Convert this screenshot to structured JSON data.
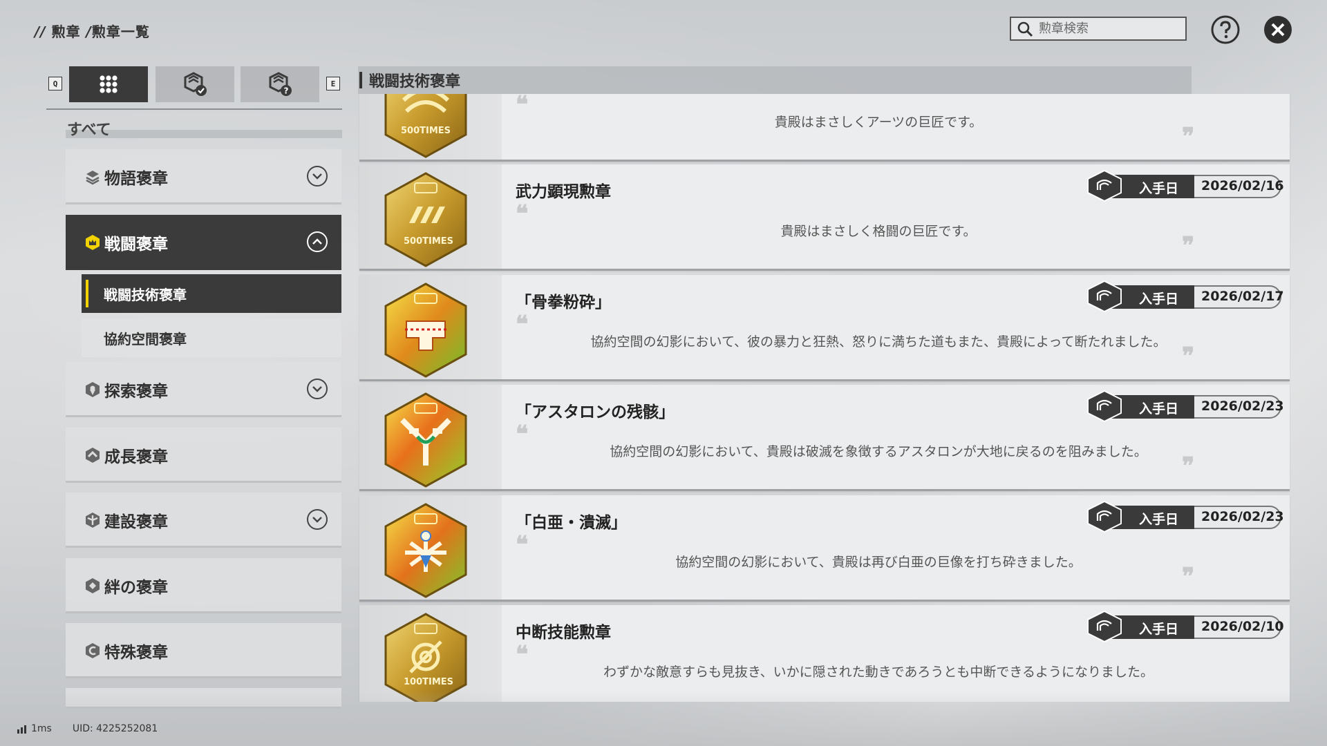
{
  "breadcrumb": {
    "prefix": "//",
    "part1": "勲章",
    "sep": "/",
    "part2": "勲章一覧"
  },
  "search": {
    "placeholder": "勲章検索",
    "value": ""
  },
  "header_buttons": {
    "help_icon": "question-circle-icon",
    "close_icon": "close-circle-icon"
  },
  "tabs": {
    "left_key": "Q",
    "right_key": "E",
    "items": [
      {
        "icon": "grid-icon",
        "active": true
      },
      {
        "icon": "medal-check-icon",
        "active": false
      },
      {
        "icon": "medal-question-icon",
        "active": false
      }
    ]
  },
  "filter": {
    "all_label": "すべて"
  },
  "categories": [
    {
      "label": "物語褒章",
      "icon": "story-icon",
      "expandable": true,
      "expanded": false
    },
    {
      "label": "戦闘褒章",
      "icon": "combat-icon",
      "expandable": true,
      "expanded": true
    },
    {
      "label": "探索褒章",
      "icon": "explore-icon",
      "expandable": true,
      "expanded": false
    },
    {
      "label": "成長褒章",
      "icon": "growth-icon",
      "expandable": false
    },
    {
      "label": "建設褒章",
      "icon": "build-icon",
      "expandable": true,
      "expanded": false
    },
    {
      "label": "絆の褒章",
      "icon": "bond-icon",
      "expandable": false
    },
    {
      "label": "特殊褒章",
      "icon": "special-icon",
      "expandable": false
    }
  ],
  "subcategories": [
    {
      "label": "戦闘技術褒章",
      "active": true
    },
    {
      "label": "協約空間褒章",
      "active": false
    }
  ],
  "section": {
    "title": "戦闘技術褒章"
  },
  "obtained_label": "入手日",
  "medals": [
    {
      "name": "",
      "desc": "貴殿はまさしくアーツの巨匠です。",
      "date": "",
      "medal_text": "500TIMES",
      "theme": "gold"
    },
    {
      "name": "武力顕現勲章",
      "desc": "貴殿はまさしく格闘の巨匠です。",
      "date": "2026/02/16",
      "medal_text": "500TIMES",
      "theme": "gold"
    },
    {
      "name": "「骨拳粉砕」",
      "desc": "協約空間の幻影において、彼の暴力と狂熱、怒りに満ちた道もまた、貴殿によって断たれました。",
      "date": "2026/02/17",
      "medal_text": "",
      "theme": "fire"
    },
    {
      "name": "「アスタロンの残骸」",
      "desc": "協約空間の幻影において、貴殿は破滅を象徴するアスタロンが大地に戻るのを阻みました。",
      "date": "2026/02/23",
      "medal_text": "",
      "theme": "fire-green"
    },
    {
      "name": "「白亜・潰滅」",
      "desc": "協約空間の幻影において、貴殿は再び白亜の巨像を打ち砕きました。",
      "date": "2026/02/23",
      "medal_text": "",
      "theme": "fire-white"
    },
    {
      "name": "中断技能勲章",
      "desc": "わずかな敵意すらも見抜き、いかに隠された動きであろうとも中断できるようになりました。",
      "date": "2026/02/10",
      "medal_text": "100TIMES",
      "theme": "gold"
    }
  ],
  "status": {
    "ping": "1ms",
    "uid": "UID: 4225252081"
  },
  "colors": {
    "accent": "#f2d200",
    "dark": "#3a3a3a",
    "gold": "#d9b23a"
  }
}
